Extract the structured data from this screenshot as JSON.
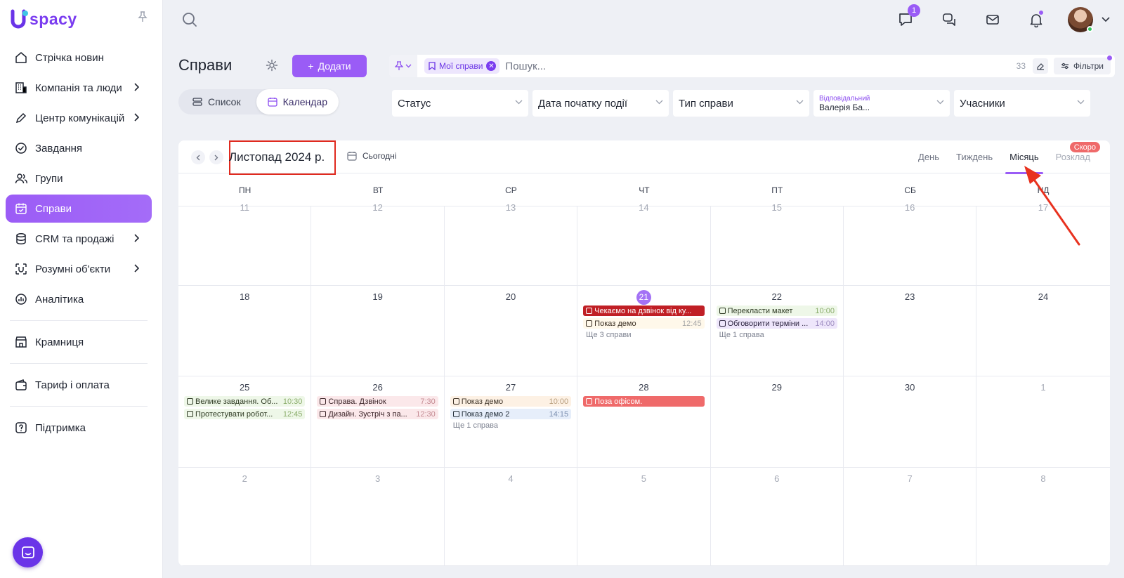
{
  "app": {
    "logo_text": "spacy"
  },
  "sidebar": {
    "items": [
      {
        "label": "Стрічка новин",
        "icon": "home-icon"
      },
      {
        "label": "Компанія та люди",
        "icon": "company-icon",
        "chevron": true
      },
      {
        "label": "Центр комунікацій",
        "icon": "communication-icon",
        "chevron": true
      },
      {
        "label": "Завдання",
        "icon": "check-circle-icon"
      },
      {
        "label": "Групи",
        "icon": "groups-icon"
      },
      {
        "label": "Справи",
        "icon": "calendar-check-icon",
        "active": true
      },
      {
        "label": "CRM та продажі",
        "icon": "database-icon",
        "chevron": true
      },
      {
        "label": "Розумні об'єкти",
        "icon": "smart-objects-icon",
        "chevron": true
      },
      {
        "label": "Аналітика",
        "icon": "analytics-icon"
      },
      {
        "label": "Крамниця",
        "icon": "store-icon"
      },
      {
        "label": "Тариф і оплата",
        "icon": "wallet-icon"
      },
      {
        "label": "Підтримка",
        "icon": "help-icon"
      }
    ]
  },
  "topbar": {
    "chat_badge": "1"
  },
  "page": {
    "title": "Справи",
    "add_label": "Додати",
    "view_list": "Список",
    "view_calendar": "Календар"
  },
  "search": {
    "chip": "Мої справи",
    "placeholder": "Пошук...",
    "count": "33",
    "filters_label": "Фільтри"
  },
  "filters": {
    "status": "Статус",
    "start_date": "Дата початку події",
    "type": "Тип справи",
    "responsible_label": "Відповідальний",
    "responsible_value": "Валерія Ба...",
    "participants": "Учасники"
  },
  "calendar": {
    "month_title": "Листопад 2024 р.",
    "today_label": "Сьогодні",
    "modes": [
      "День",
      "Тиждень",
      "Місяць",
      "Розклад"
    ],
    "active_mode": "Місяць",
    "soon_badge": "Скоро",
    "weekdays": [
      "ПН",
      "ВТ",
      "СР",
      "ЧТ",
      "ПТ",
      "СБ",
      "НД"
    ],
    "weeks": [
      {
        "days": [
          {
            "num": "11"
          },
          {
            "num": "12"
          },
          {
            "num": "13"
          },
          {
            "num": "14"
          },
          {
            "num": "15"
          },
          {
            "num": "16"
          },
          {
            "num": "17"
          }
        ]
      },
      {
        "days": [
          {
            "num": "18"
          },
          {
            "num": "19"
          },
          {
            "num": "20"
          },
          {
            "num": "21",
            "today": true,
            "events": [
              {
                "title": "Чекаємо на дзвінок від ку...",
                "time": "",
                "style": "dark"
              },
              {
                "title": "Показ демо",
                "time": "12:45",
                "style": "plain"
              }
            ],
            "more": "Ще 3 справи"
          },
          {
            "num": "22",
            "events": [
              {
                "title": "Перекласти макет",
                "time": "10:00",
                "style": "green"
              },
              {
                "title": "Обговорити терміни ...",
                "time": "14:00",
                "style": "lilac"
              }
            ],
            "more": "Ще 1 справа"
          },
          {
            "num": "23"
          },
          {
            "num": "24"
          }
        ]
      },
      {
        "days": [
          {
            "num": "25",
            "events": [
              {
                "title": "Велике завдання. Об...",
                "time": "10:30",
                "style": "green"
              },
              {
                "title": "Протестувати робот...",
                "time": "12:45",
                "style": "green"
              }
            ]
          },
          {
            "num": "26",
            "events": [
              {
                "title": "Справа. Дзвінок",
                "time": "7:30",
                "style": "pink"
              },
              {
                "title": "Дизайн. Зустріч з па...",
                "time": "12:30",
                "style": "pink"
              }
            ]
          },
          {
            "num": "27",
            "events": [
              {
                "title": "Показ демо",
                "time": "10:00",
                "style": "peach"
              },
              {
                "title": "Показ демо 2",
                "time": "14:15",
                "style": "blue"
              }
            ],
            "more": "Ще 1 справа"
          },
          {
            "num": "28",
            "events": [
              {
                "title": "Поза офісом.",
                "time": "",
                "style": "red"
              }
            ]
          },
          {
            "num": "29"
          },
          {
            "num": "30"
          },
          {
            "num": "1",
            "muted": true
          }
        ]
      },
      {
        "days": [
          {
            "num": "2",
            "muted": true
          },
          {
            "num": "3",
            "muted": true
          },
          {
            "num": "4",
            "muted": true
          },
          {
            "num": "5",
            "muted": true
          },
          {
            "num": "6",
            "muted": true
          },
          {
            "num": "7",
            "muted": true
          },
          {
            "num": "8",
            "muted": true
          }
        ]
      }
    ]
  },
  "colors": {
    "accent": "#9a5cf6",
    "highlight_box": "#e02a1f",
    "annotation_arrow": "#e8321f"
  }
}
